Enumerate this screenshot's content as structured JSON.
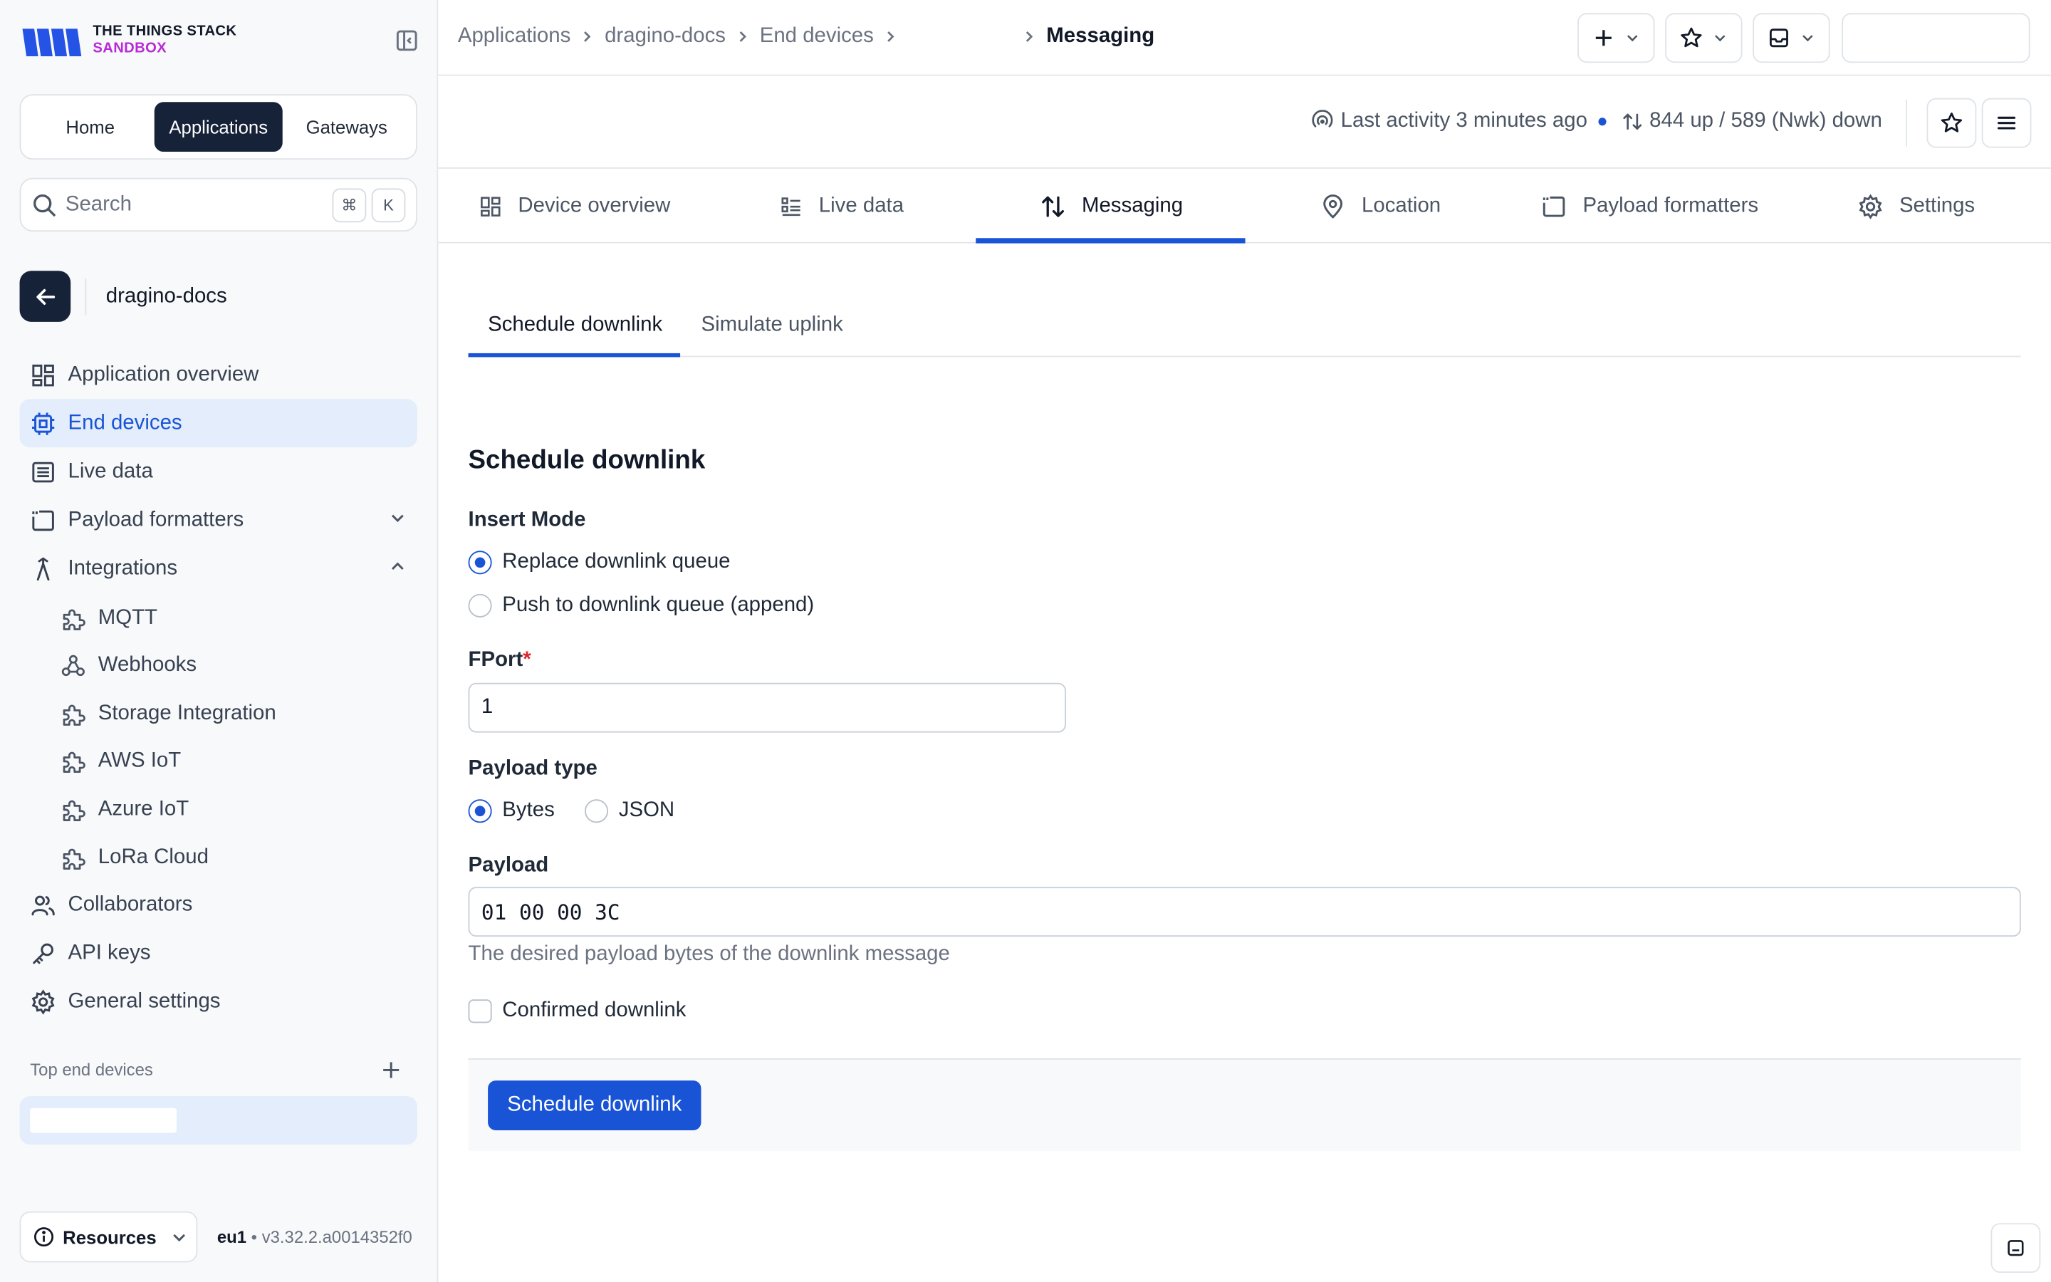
{
  "brand": {
    "line1": "THE THINGS STACK",
    "line2": "SANDBOX"
  },
  "top_nav": {
    "home": "Home",
    "applications": "Applications",
    "gateways": "Gateways"
  },
  "search": {
    "label": "Search",
    "kbd_cmd": "⌘",
    "kbd_k": "K"
  },
  "application": {
    "name": "dragino-docs"
  },
  "sidebar": {
    "items": [
      {
        "label": "Application overview",
        "icon": "grid-icon"
      },
      {
        "label": "End devices",
        "icon": "chip-icon",
        "active": true
      },
      {
        "label": "Live data",
        "icon": "list-icon"
      },
      {
        "label": "Payload formatters",
        "icon": "code-icon",
        "expandable": "collapsed"
      },
      {
        "label": "Integrations",
        "icon": "integrations-icon",
        "expandable": "expanded"
      }
    ],
    "integrations": [
      {
        "label": "MQTT",
        "icon": "puzzle-icon"
      },
      {
        "label": "Webhooks",
        "icon": "webhook-icon"
      },
      {
        "label": "Storage Integration",
        "icon": "puzzle-icon"
      },
      {
        "label": "AWS IoT",
        "icon": "puzzle-icon"
      },
      {
        "label": "Azure IoT",
        "icon": "puzzle-icon"
      },
      {
        "label": "LoRa Cloud",
        "icon": "puzzle-icon"
      }
    ],
    "more": [
      {
        "label": "Collaborators",
        "icon": "users-icon"
      },
      {
        "label": "API keys",
        "icon": "key-icon"
      },
      {
        "label": "General settings",
        "icon": "gear-icon"
      }
    ],
    "top_devices_title": "Top end devices",
    "resources_label": "Resources",
    "region": "eu1",
    "version": "v3.32.2.a0014352f0"
  },
  "breadcrumb": {
    "applications": "Applications",
    "app": "dragino-docs",
    "end_devices": "End devices",
    "current": "Messaging"
  },
  "device": {
    "last_activity": "Last activity 3 minutes ago",
    "traffic": "844 up / 589 (Nwk) down"
  },
  "tabs": {
    "overview": "Device overview",
    "live_data": "Live data",
    "messaging": "Messaging",
    "location": "Location",
    "payload_formatters": "Payload formatters",
    "settings": "Settings"
  },
  "subtabs": {
    "schedule": "Schedule downlink",
    "simulate": "Simulate uplink"
  },
  "form": {
    "title": "Schedule downlink",
    "insert_mode_label": "Insert Mode",
    "insert_replace": "Replace downlink queue",
    "insert_push": "Push to downlink queue (append)",
    "insert_mode_selected": "replace",
    "fport_label": "FPort",
    "fport_required": "*",
    "fport_value": "1",
    "payload_type_label": "Payload type",
    "payload_type_bytes": "Bytes",
    "payload_type_json": "JSON",
    "payload_type_selected": "bytes",
    "payload_label": "Payload",
    "payload_value": "01 00 00 3C",
    "payload_hint": "The desired payload bytes of the downlink message",
    "confirmed_label": "Confirmed downlink",
    "confirmed": false,
    "submit_label": "Schedule downlink"
  },
  "colors": {
    "accent": "#1a54d6",
    "dark": "#162238",
    "brand_purple": "#b82ad6",
    "active_bg": "#e3edfc"
  }
}
